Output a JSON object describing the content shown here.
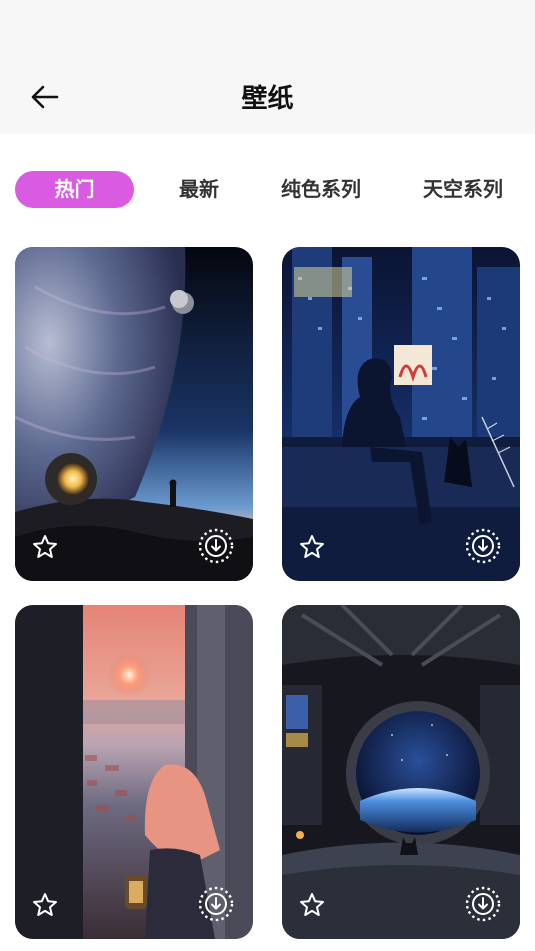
{
  "header": {
    "title": "壁纸",
    "back_icon": "arrow-left-icon"
  },
  "tabs": [
    {
      "label": "热门",
      "active": true
    },
    {
      "label": "最新",
      "active": false
    },
    {
      "label": "纯色系列",
      "active": false
    },
    {
      "label": "天空系列",
      "active": false
    }
  ],
  "colors": {
    "accent": "#d85be2",
    "header_bg": "#f7f7f7"
  },
  "wallpapers": [
    {
      "subject": "space-planet-astronaut",
      "favorite_icon": "star-icon",
      "download_icon": "download-icon"
    },
    {
      "subject": "night-city-girl-cat",
      "favorite_icon": "star-icon",
      "download_icon": "download-icon"
    },
    {
      "subject": "sunset-girl-lantern",
      "favorite_icon": "star-icon",
      "download_icon": "download-icon"
    },
    {
      "subject": "spaceship-window-cat",
      "favorite_icon": "star-icon",
      "download_icon": "download-icon"
    }
  ]
}
